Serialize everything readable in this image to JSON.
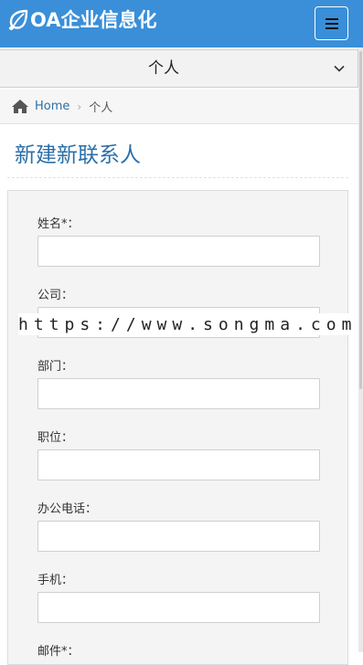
{
  "app": {
    "brand": "OA企业信息化",
    "brand_icon": "leaf-icon",
    "menu_icon": "hamburger-icon",
    "accent_color": "#3a8fd8"
  },
  "selector": {
    "value": "个人",
    "icon": "chevron-down-icon"
  },
  "breadcrumb": {
    "icon": "home-icon",
    "home": "Home",
    "separator": "›",
    "current": "个人"
  },
  "page": {
    "title": "新建新联系人"
  },
  "form": {
    "fields": [
      {
        "label": "姓名*：",
        "value": ""
      },
      {
        "label": "公司：",
        "value": ""
      },
      {
        "label": "部门：",
        "value": ""
      },
      {
        "label": "职位：",
        "value": ""
      },
      {
        "label": "办公电话：",
        "value": ""
      },
      {
        "label": "手机：",
        "value": ""
      },
      {
        "label": "邮件*：",
        "value": ""
      }
    ]
  },
  "watermark": {
    "text": "https://www.songma.com"
  }
}
